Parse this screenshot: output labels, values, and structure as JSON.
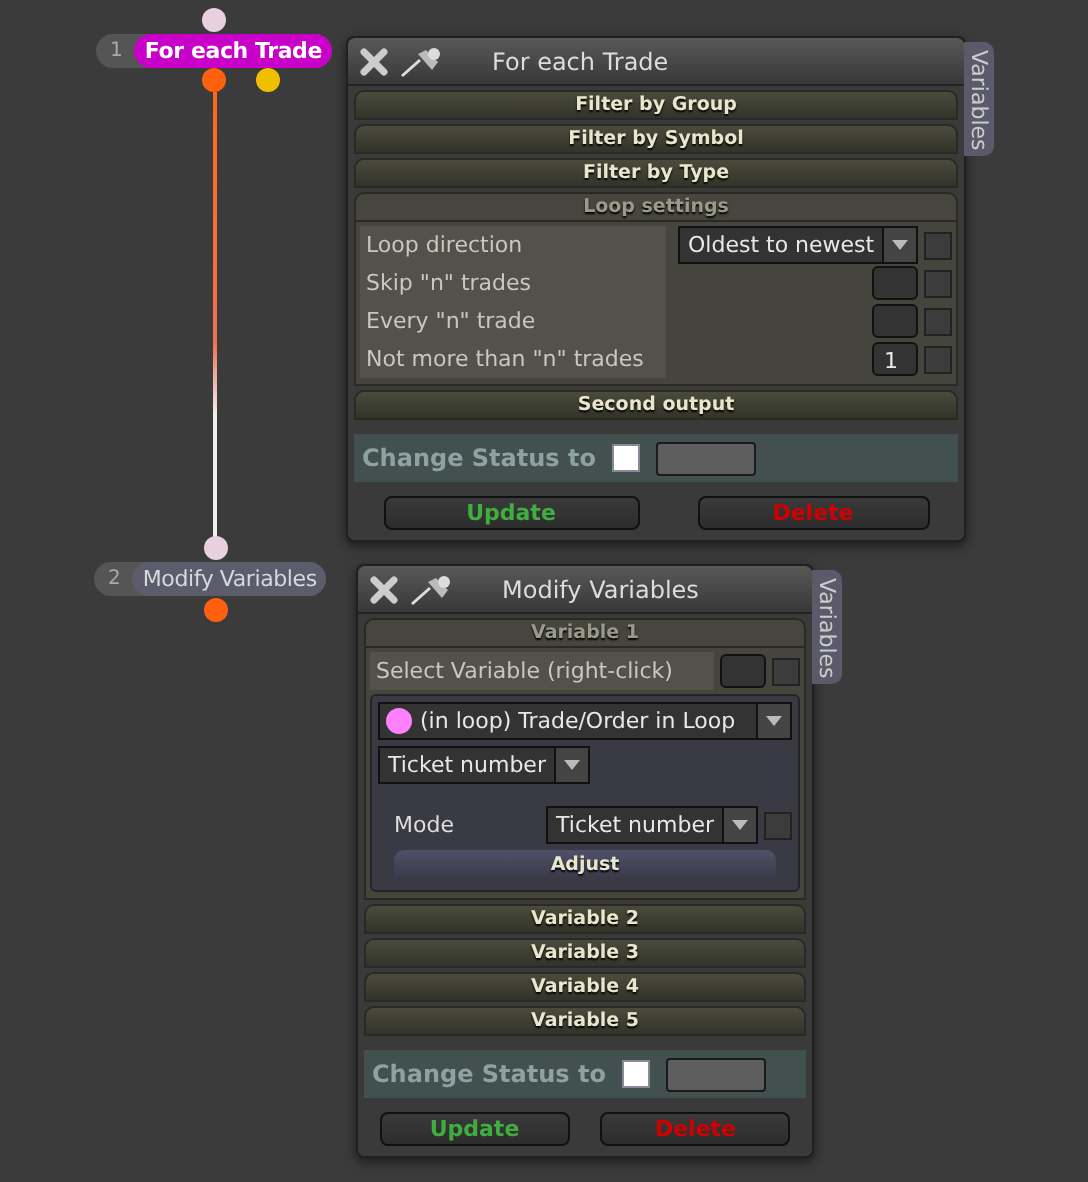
{
  "nodes": [
    {
      "number": "1",
      "label": "For each Trade",
      "selected": true
    },
    {
      "number": "2",
      "label": "Modify Variables",
      "selected": false
    }
  ],
  "panels": [
    {
      "title": "For each Trade",
      "side_tab": "Variables",
      "sections": [
        {
          "label": "Filter by Group",
          "expanded": false
        },
        {
          "label": "Filter by Symbol",
          "expanded": false
        },
        {
          "label": "Filter by Type",
          "expanded": false
        },
        {
          "label": "Loop settings",
          "expanded": true,
          "rows": [
            {
              "kind": "setting",
              "label": "Loop direction",
              "control": {
                "kind": "dropdown",
                "value": "Oldest to newest"
              },
              "checked": false
            },
            {
              "kind": "setting",
              "label": "Skip \"n\" trades",
              "control": {
                "kind": "input"
              },
              "checked": false
            },
            {
              "kind": "setting",
              "label": "Every \"n\" trade",
              "control": {
                "kind": "input"
              },
              "checked": false
            },
            {
              "kind": "setting",
              "label": "Not more than \"n\" trades",
              "control": {
                "kind": "input",
                "value": "1"
              },
              "checked": false
            }
          ]
        },
        {
          "label": "Second output",
          "expanded": false
        }
      ],
      "status": {
        "label": "Change Status to",
        "checked": false
      },
      "buttons": [
        {
          "label": "Update",
          "kind": "update"
        },
        {
          "label": "Delete",
          "kind": "delete"
        }
      ]
    },
    {
      "title": "Modify Variables",
      "side_tab": "Variables",
      "sections": [
        {
          "label": "Variable 1",
          "expanded": true,
          "rows": [
            {
              "kind": "select",
              "label": "Select Variable (right-click)",
              "checked": false
            }
          ],
          "inner": [
            {
              "kind": "source",
              "value": "(in loop) Trade/Order in Loop"
            },
            {
              "kind": "dropdown",
              "value": "Ticket number"
            },
            {
              "kind": "setting",
              "label": "Mode",
              "control": {
                "kind": "dropdown",
                "value": "Ticket number"
              },
              "checked": false
            },
            {
              "kind": "button",
              "label": "Adjust"
            }
          ]
        },
        {
          "label": "Variable 2",
          "expanded": false
        },
        {
          "label": "Variable 3",
          "expanded": false
        },
        {
          "label": "Variable 4",
          "expanded": false
        },
        {
          "label": "Variable 5",
          "expanded": false
        }
      ],
      "status": {
        "label": "Change Status to",
        "checked": false
      },
      "buttons": [
        {
          "label": "Update",
          "kind": "update"
        },
        {
          "label": "Delete",
          "kind": "delete"
        }
      ]
    }
  ]
}
